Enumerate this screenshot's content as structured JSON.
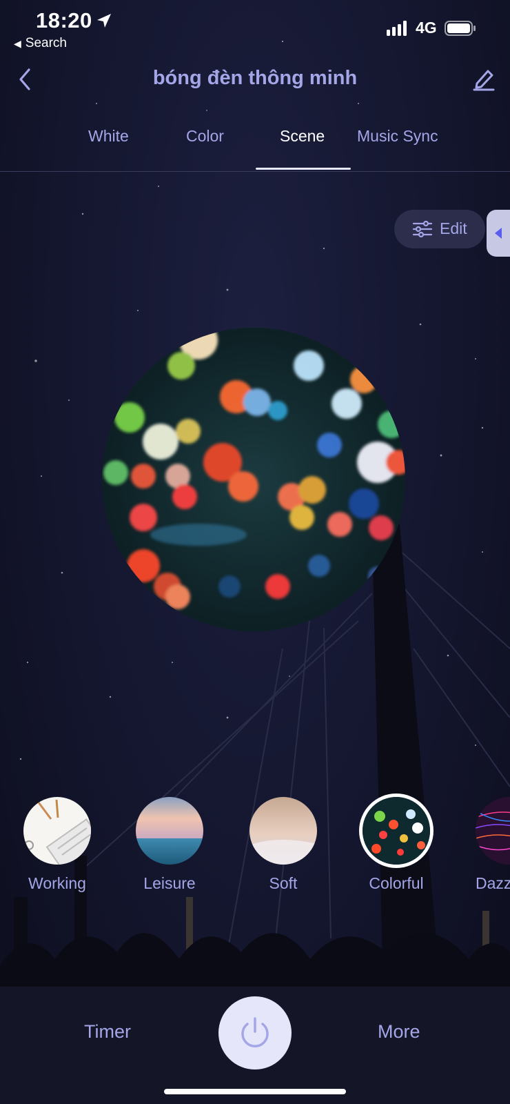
{
  "status_bar": {
    "time": "18:20",
    "back_app": "Search",
    "network": "4G"
  },
  "header": {
    "title": "bóng đèn thông minh"
  },
  "tabs": [
    {
      "label": "White",
      "active": false
    },
    {
      "label": "Color",
      "active": false
    },
    {
      "label": "Scene",
      "active": true
    },
    {
      "label": "Music Sync",
      "active": false
    }
  ],
  "edit_button": {
    "label": "Edit"
  },
  "scenes": [
    {
      "label": "Working",
      "active": false
    },
    {
      "label": "Leisure",
      "active": false
    },
    {
      "label": "Soft",
      "active": false
    },
    {
      "label": "Colorful",
      "active": true
    },
    {
      "label": "Dazz",
      "active": false
    }
  ],
  "bottom_bar": {
    "timer_label": "Timer",
    "more_label": "More"
  },
  "colors": {
    "accent": "#a4a6e8",
    "background": "#14162e",
    "power_button": "#e6e6fb"
  },
  "icons": {
    "back": "chevron-left-icon",
    "edit_title": "pencil-icon",
    "edit_scene": "sliders-icon",
    "power": "power-icon",
    "location": "location-arrow-icon"
  }
}
